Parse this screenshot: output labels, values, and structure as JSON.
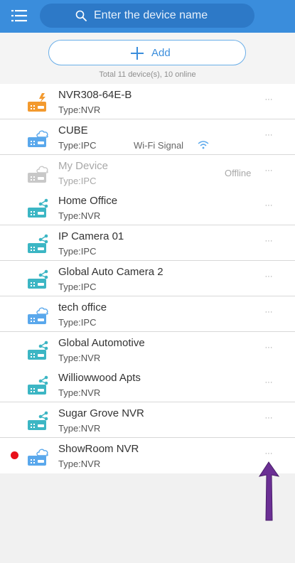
{
  "header": {
    "search_placeholder": "Enter the device name"
  },
  "add_button": {
    "label": "Add"
  },
  "summary": "Total 11 device(s), 10 online",
  "colors": {
    "header": "#3a8ddc",
    "nvr_icon_online": "#f39a2f",
    "icon_teal": "#3cb6c4",
    "icon_cloud": "#5aa8ec",
    "icon_offline": "#c8c8c8",
    "alert_dot": "#e8101a",
    "annotation_arrow": "#6b2f94"
  },
  "more_label": "···",
  "devices": [
    {
      "name": "NVR308-64E-B",
      "type": "Type:NVR",
      "icon": "nvr-alert-icon"
    },
    {
      "name": "CUBE",
      "type": "Type:IPC",
      "icon": "cloud-device-icon",
      "signal_label": "Wi-Fi Signal"
    },
    {
      "name": "My Device",
      "type": "Type:IPC",
      "icon": "cloud-device-offline-icon",
      "status": "Offline"
    },
    {
      "name": "Home Office",
      "type": "Type:NVR",
      "icon": "share-device-icon"
    },
    {
      "name": "IP Camera 01",
      "type": "Type:IPC",
      "icon": "share-device-icon"
    },
    {
      "name": "Global Auto Camera 2",
      "type": "Type:IPC",
      "icon": "share-device-icon"
    },
    {
      "name": "tech office",
      "type": "Type:IPC",
      "icon": "cloud-device-icon"
    },
    {
      "name": "Global Automotive",
      "type": "Type:NVR",
      "icon": "share-device-icon"
    },
    {
      "name": "Williowwood Apts",
      "type": "Type:NVR",
      "icon": "share-device-icon"
    },
    {
      "name": "Sugar Grove NVR",
      "type": "Type:NVR",
      "icon": "share-device-icon"
    },
    {
      "name": "ShowRoom NVR",
      "type": "Type:NVR",
      "icon": "cloud-device-icon",
      "alert": true
    }
  ]
}
